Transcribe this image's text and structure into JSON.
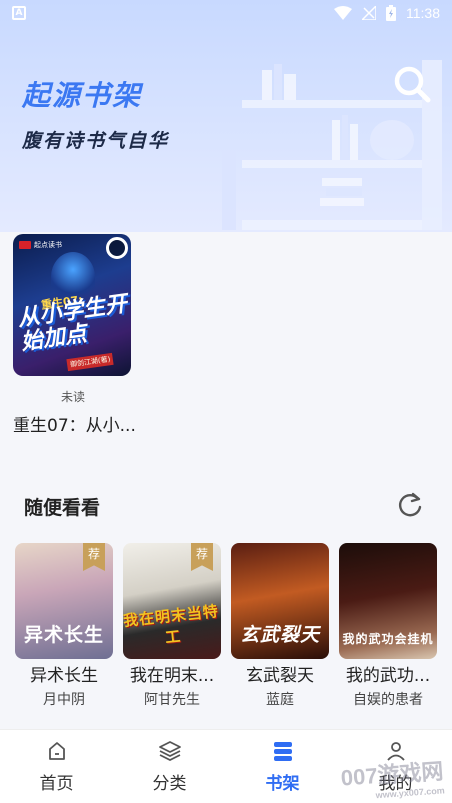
{
  "status_bar": {
    "time": "11:38"
  },
  "header": {
    "title": "起源书架",
    "subtitle": "腹有诗书气自华"
  },
  "bookshelf": {
    "books": [
      {
        "cover_brand": "起点读书",
        "cover_small_title": "重生07:",
        "cover_title": "从小学生开始加点",
        "cover_author": "御剑江湖(著)",
        "status": "未读",
        "name": "重生07：从小..."
      }
    ]
  },
  "recommend": {
    "title": "随便看看",
    "items": [
      {
        "name": "异术长生",
        "author": "月中阴",
        "cover_text": "异术长生",
        "badge": "荐"
      },
      {
        "name": "我在明末...",
        "author": "阿甘先生",
        "cover_text": "我在明末当特工",
        "badge": "荐"
      },
      {
        "name": "玄武裂天",
        "author": "蓝庭",
        "cover_text": "玄武裂天",
        "badge": ""
      },
      {
        "name": "我的武功...",
        "author": "自娱的患者",
        "cover_text": "我的武功会挂机",
        "badge": ""
      }
    ]
  },
  "bottom_nav": {
    "items": [
      {
        "label": "首页",
        "icon": "home-icon"
      },
      {
        "label": "分类",
        "icon": "layers-icon"
      },
      {
        "label": "书架",
        "icon": "bookshelf-icon",
        "active": true
      },
      {
        "label": "我的",
        "icon": "user-icon"
      }
    ]
  },
  "watermark": {
    "text": "007游戏网",
    "url": "www.yx007.com"
  },
  "colors": {
    "accent": "#2f6df3",
    "title": "#3b78f2"
  }
}
